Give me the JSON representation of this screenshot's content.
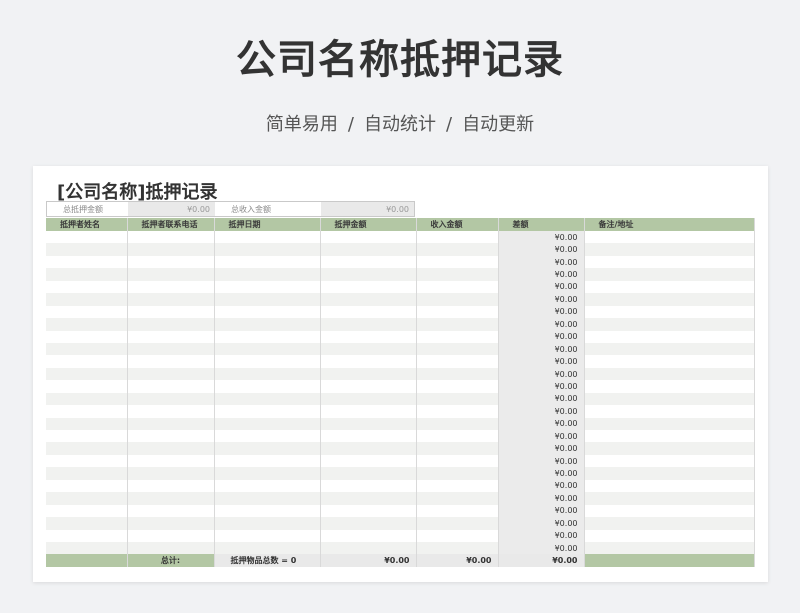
{
  "hero": {
    "title": "公司名称抵押记录",
    "tags": [
      "简单易用",
      "自动统计",
      "自动更新"
    ],
    "separator": "/"
  },
  "sheet": {
    "title": "[公司名称]抵押记录",
    "summary": {
      "total_pledge_label": "总抵押金额",
      "total_pledge_value": "¥0.00",
      "total_income_label": "总收入金额",
      "total_income_value": "¥0.00"
    },
    "columns": [
      "抵押者姓名",
      "抵押者联系电话",
      "抵押日期",
      "抵押金额",
      "收入金额",
      "差额",
      "备注/地址"
    ],
    "row_count": 26,
    "row_diff_value": "¥0.00",
    "footer": {
      "total_label": "总计:",
      "items_label": "抵押物品总数 = 0",
      "pledge_total": "¥0.00",
      "income_total": "¥0.00",
      "diff_total": "¥0.00"
    }
  },
  "colors": {
    "header_green": "#b3c7a4",
    "title_text": "#333333",
    "page_bg": "#f1f2f4"
  }
}
